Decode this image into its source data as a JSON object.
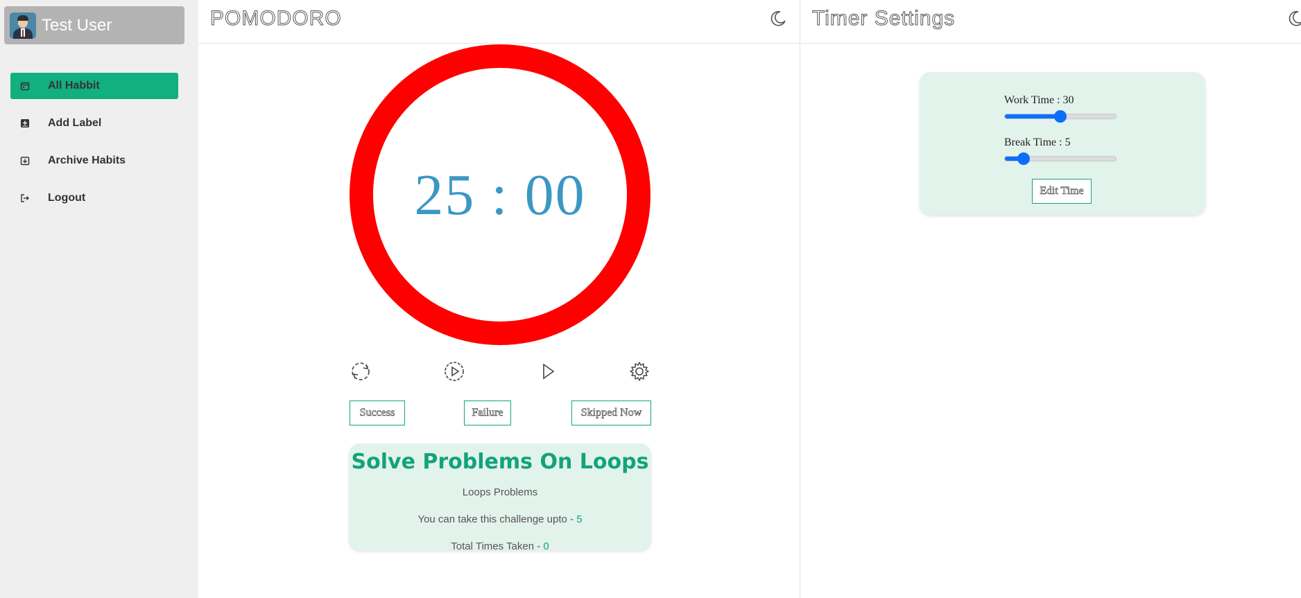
{
  "sidebar": {
    "user_name": "Test User",
    "items": [
      {
        "label": "All Habbit",
        "icon": "calendar-icon",
        "active": true
      },
      {
        "label": "Add Label",
        "icon": "add-box-icon",
        "active": false
      },
      {
        "label": "Archive Habits",
        "icon": "archive-icon",
        "active": false
      },
      {
        "label": "Logout",
        "icon": "logout-icon",
        "active": false
      }
    ]
  },
  "pomodoro": {
    "title": "POMODORO",
    "timer": "25 : 00",
    "controls": [
      "reset-icon",
      "play-circle-icon",
      "play-icon",
      "settings-gear-icon"
    ],
    "buttons": {
      "success": "Success",
      "failure": "Failure",
      "skipped": "Skipped Now"
    },
    "habit": {
      "title": "Solve Problems On Loops",
      "description": "Loops Problems",
      "challenge_label": "You can take this challenge upto - ",
      "challenge_value": "5",
      "taken_label": "Total Times Taken - ",
      "taken_value": "0"
    }
  },
  "settings": {
    "title": "Timer Settings",
    "work_label": "Work Time : 30",
    "work_value": 30,
    "break_label": "Break Time : 5",
    "break_value": 5,
    "edit_button": "Edit Time"
  },
  "colors": {
    "accent": "#12b07f",
    "timer_ring": "#ff0000",
    "timer_text": "#3c97c4",
    "slider": "#0d6efd"
  }
}
